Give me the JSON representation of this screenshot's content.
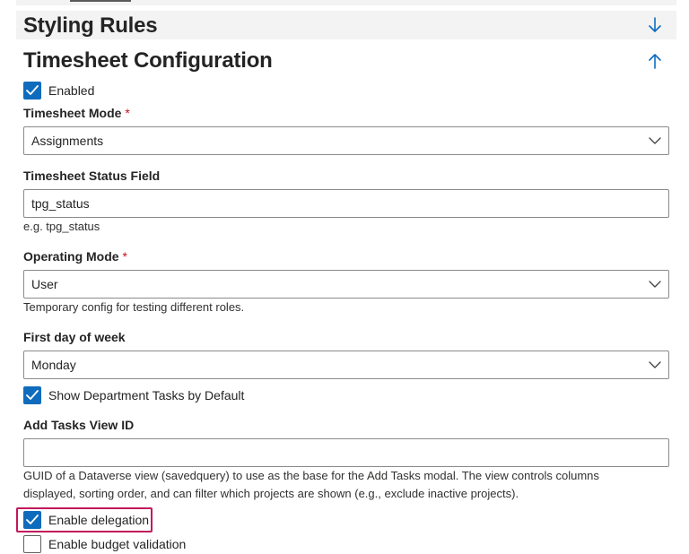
{
  "sections": {
    "styling_rules": {
      "title": "Styling Rules",
      "toggle_icon": "arrow-down-icon"
    },
    "timesheet_config": {
      "title": "Timesheet Configuration",
      "toggle_icon": "arrow-up-icon"
    }
  },
  "fields": {
    "enabled": {
      "label": "Enabled",
      "checked": true
    },
    "timesheet_mode": {
      "label": "Timesheet Mode",
      "required_mark": "*",
      "value": "Assignments"
    },
    "timesheet_status_field": {
      "label": "Timesheet Status Field",
      "value": "tpg_status",
      "hint": "e.g. tpg_status"
    },
    "operating_mode": {
      "label": "Operating Mode",
      "required_mark": "*",
      "value": "User",
      "hint": "Temporary config for testing different roles."
    },
    "first_day_of_week": {
      "label": "First day of week",
      "value": "Monday"
    },
    "show_department_tasks": {
      "label": "Show Department Tasks by Default",
      "checked": true
    },
    "add_tasks_view_id": {
      "label": "Add Tasks View ID",
      "value": "",
      "hint_line1": "GUID of a Dataverse view (savedquery) to use as the base for the Add Tasks modal. The view controls columns",
      "hint_line2": "displayed, sorting order, and can filter which projects are shown (e.g., exclude inactive projects)."
    },
    "enable_delegation": {
      "label": "Enable delegation",
      "checked": true
    },
    "enable_budget_validation": {
      "label": "Enable budget validation",
      "checked": false
    }
  },
  "colors": {
    "accent": "#0f6cbd",
    "required": "#c50f1f",
    "highlight": "#c2185b"
  }
}
